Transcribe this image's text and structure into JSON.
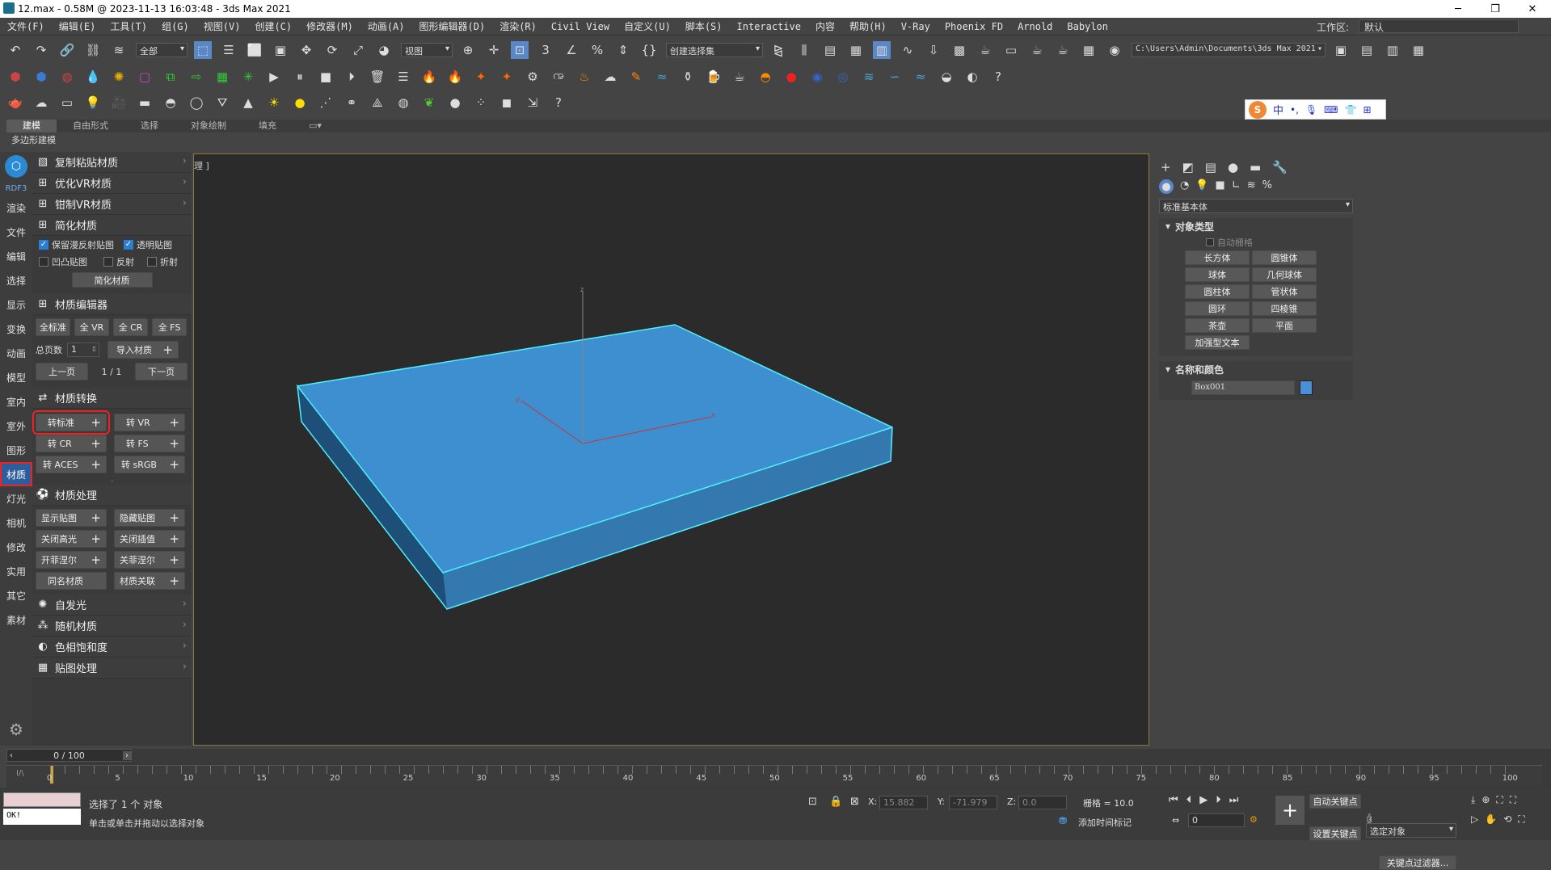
{
  "window": {
    "title": "12.max - 0.58M @ 2023-11-13 16:03:48 - 3ds Max 2021",
    "minimize": "─",
    "maximize": "❐",
    "close": "✕"
  },
  "menu": [
    "文件(F)",
    "编辑(E)",
    "工具(T)",
    "组(G)",
    "视图(V)",
    "创建(C)",
    "修改器(M)",
    "动画(A)",
    "图形编辑器(D)",
    "渲染(R)",
    "Civil View",
    "自定义(U)",
    "脚本(S)",
    "Interactive",
    "内容",
    "帮助(H)",
    "V-Ray",
    "Phoenix FD",
    "Arnold",
    "Babylon"
  ],
  "workspace": {
    "label": "工作区:",
    "value": "默认"
  },
  "toolbar": {
    "filter": "全部",
    "refcoord": "视图",
    "selset": "创建选择集",
    "path": "C:\\Users\\Admin\\Documents\\3ds Max 2021"
  },
  "ime": {
    "label": "中"
  },
  "ribbon_tabs": [
    "建模",
    "自由形式",
    "选择",
    "对象绘制",
    "填充"
  ],
  "subtab": "多边形建模",
  "leftbar": [
    "RDF3",
    "渲染",
    "文件",
    "编辑",
    "选择",
    "显示",
    "变换",
    "动画",
    "模型",
    "室内",
    "室外",
    "图形",
    "材质",
    "灯光",
    "相机",
    "修改",
    "实用",
    "其它",
    "素材"
  ],
  "panel": {
    "copy_paste": "复制粘贴材质",
    "optimize_vr": "优化VR材质",
    "limit_vr": "钳制VR材质",
    "simplify": {
      "title": "简化材质",
      "keep_reflect": "保留漫反射贴图",
      "transparent": "透明贴图",
      "bump": "凹凸贴图",
      "reflect": "反射",
      "refract": "折射",
      "button": "简化材质"
    },
    "editor": {
      "title": "材质编辑器",
      "all_std": "全标准",
      "all_vr": "全 VR",
      "all_cr": "全 CR",
      "all_fs": "全 FS",
      "pages_label": "总页数",
      "pages_value": "1",
      "import": "导入材质",
      "prev": "上一页",
      "page": "1 / 1",
      "next": "下一页"
    },
    "convert": {
      "title": "材质转换",
      "std": "转标准",
      "vr": "转 VR",
      "cr": "转 CR",
      "fs": "转 FS",
      "aces": "转 ACES",
      "srgb": "转 sRGB"
    },
    "process": {
      "title": "材质处理",
      "show_map": "显示贴图",
      "hide_map": "隐藏贴图",
      "close_hl": "关闭高光",
      "close_interp": "关闭插值",
      "open_fresnel": "开菲涅尔",
      "close_fresnel": "关菲涅尔",
      "same_name": "同名材质",
      "link": "材质关联"
    },
    "self_illum": "自发光",
    "random": "随机材质",
    "hue": "色相饱和度",
    "map_proc": "贴图处理"
  },
  "viewport": {
    "label": "理 ]"
  },
  "command_panel": {
    "category": "标准基本体",
    "object_type": "对象类型",
    "autogrid": "自动栅格",
    "objects": [
      "长方体",
      "圆锥体",
      "球体",
      "几何球体",
      "圆柱体",
      "管状体",
      "圆环",
      "四棱锥",
      "茶壶",
      "平面"
    ],
    "text_plus": "加强型文本",
    "name_color": "名称和颜色",
    "object_name": "Box001",
    "object_color": "#4a90d9"
  },
  "timeline": {
    "frame": "0 / 100",
    "ticks": [
      "0",
      "5",
      "10",
      "15",
      "20",
      "25",
      "30",
      "35",
      "40",
      "45",
      "50",
      "55",
      "60",
      "65",
      "70",
      "75",
      "80",
      "85",
      "90",
      "95",
      "100"
    ]
  },
  "status": {
    "selected": "选择了 1 个 对象",
    "hint": "单击或单击并拖动以选择对象",
    "ok": "OK!",
    "x_label": "X:",
    "x": "15.882",
    "y_label": "Y:",
    "y": "-71.979",
    "z_label": "Z:",
    "z": "0.0",
    "grid": "栅格 = 10.0",
    "add_time_tag": "添加时间标记",
    "auto_key": "自动关键点",
    "set_key": "设置关键点",
    "selected_obj": "选定对象",
    "key_filter": "关键点过滤器...",
    "frame_value": "0"
  }
}
